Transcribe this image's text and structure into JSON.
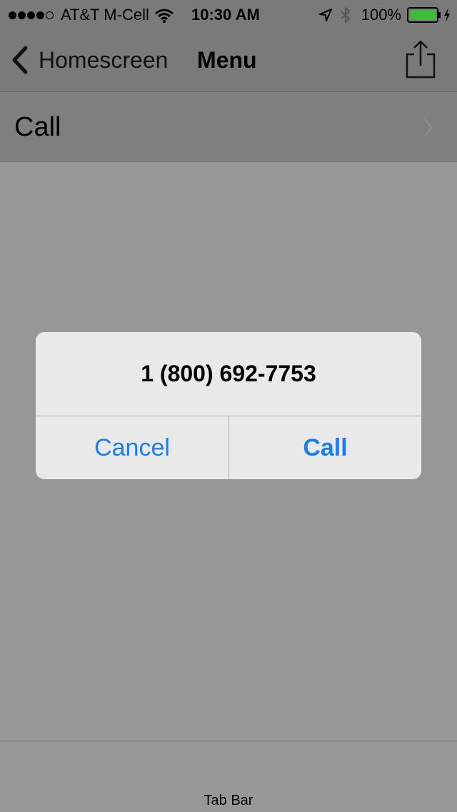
{
  "status_bar": {
    "signal_bars_filled": 4,
    "signal_bars_total": 5,
    "carrier": "AT&T M-Cell",
    "time": "10:30 AM",
    "battery_percent": "100%",
    "icons": [
      "wifi-icon",
      "location-arrow-icon",
      "bluetooth-icon",
      "battery-icon",
      "charging-bolt-icon"
    ],
    "battery_color": "#3fbd3a"
  },
  "nav": {
    "back_label": "Homescreen",
    "title": "Menu",
    "share_icon": "share-icon"
  },
  "table": {
    "rows": [
      {
        "label": "Call"
      }
    ]
  },
  "alert": {
    "message": "1 (800) 692-7753",
    "cancel_label": "Cancel",
    "call_label": "Call",
    "button_color": "#1a7fe8"
  },
  "tab_bar": {
    "label": "Tab Bar"
  }
}
